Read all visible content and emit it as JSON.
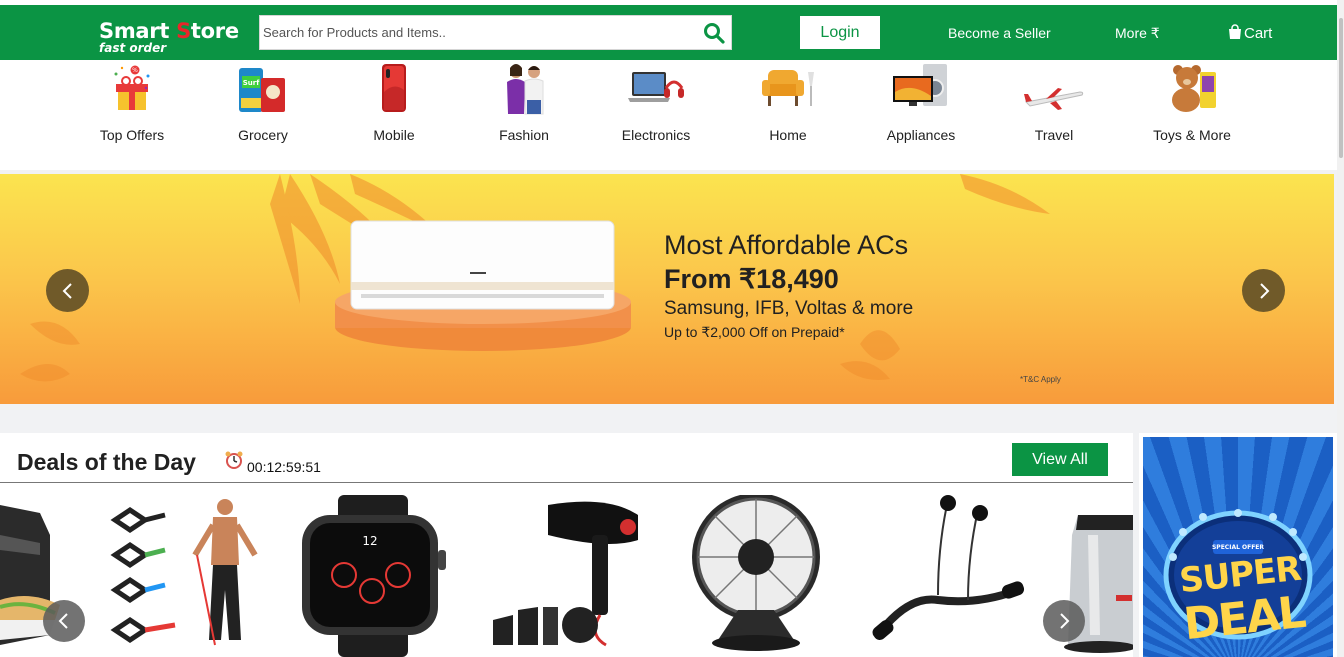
{
  "header": {
    "logo_main_a": "Smart ",
    "logo_main_b": "S",
    "logo_main_c": "tore",
    "logo_sub": "fast order",
    "search_placeholder": "Search for Products and Items..",
    "login_label": "Login",
    "seller_label": "Become a Seller",
    "more_label": "More ₹",
    "cart_label": "Cart",
    "brand_color": "#0b9444"
  },
  "categories": [
    {
      "label": "Top Offers",
      "icon": "gift-icon"
    },
    {
      "label": "Grocery",
      "icon": "grocery-icon"
    },
    {
      "label": "Mobile",
      "icon": "mobile-phone-icon"
    },
    {
      "label": "Fashion",
      "icon": "fashion-couple-icon"
    },
    {
      "label": "Electronics",
      "icon": "laptop-icon"
    },
    {
      "label": "Home",
      "icon": "armchair-icon"
    },
    {
      "label": "Appliances",
      "icon": "tv-washer-icon"
    },
    {
      "label": "Travel",
      "icon": "airplane-icon"
    },
    {
      "label": "Toys & More",
      "icon": "teddy-bear-icon"
    }
  ],
  "banner": {
    "title": "Most Affordable ACs",
    "price": "From ₹18,490",
    "brands": "Samsung, IFB, Voltas & more",
    "offer": "Up to ₹2,000 Off on Prepaid*",
    "tc": "*T&C Apply"
  },
  "deals": {
    "title": "Deals of the Day",
    "timer": "00:12:59:51",
    "view_all": "View All",
    "products": [
      "sandwich-maker",
      "resistance-bands",
      "smartwatch",
      "hair-dryer",
      "table-fan",
      "neckband-earphones",
      "electric-kettle"
    ]
  },
  "side_ad": {
    "special": "SPECIAL OFFER",
    "line1": "SUPER",
    "line2": "DEAL"
  }
}
